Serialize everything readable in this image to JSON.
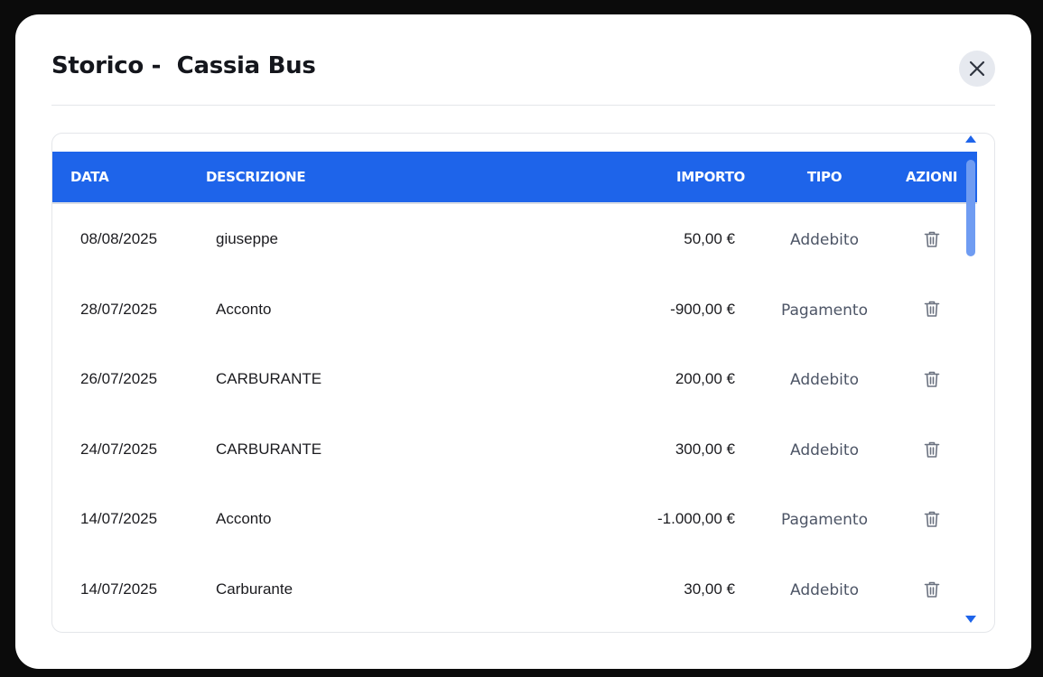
{
  "modal": {
    "title": "Storico -  Cassia Bus",
    "close_icon": "close-icon"
  },
  "table": {
    "headers": {
      "date": "DATA",
      "description": "DESCRIZIONE",
      "amount": "IMPORTO",
      "type": "TIPO",
      "actions": "AZIONI"
    },
    "rows": [
      {
        "date": "08/08/2025",
        "description": "giuseppe",
        "amount": "50,00 €",
        "type": "Addebito",
        "action_icon": "trash-icon"
      },
      {
        "date": "28/07/2025",
        "description": "Acconto",
        "amount": "-900,00 €",
        "type": "Pagamento",
        "action_icon": "trash-icon"
      },
      {
        "date": "26/07/2025",
        "description": "CARBURANTE",
        "amount": "200,00 €",
        "type": "Addebito",
        "action_icon": "trash-icon"
      },
      {
        "date": "24/07/2025",
        "description": "CARBURANTE",
        "amount": "300,00 €",
        "type": "Addebito",
        "action_icon": "trash-icon"
      },
      {
        "date": "14/07/2025",
        "description": "Acconto",
        "amount": "-1.000,00 €",
        "type": "Pagamento",
        "action_icon": "trash-icon"
      },
      {
        "date": "14/07/2025",
        "description": "Carburante",
        "amount": "30,00 €",
        "type": "Addebito",
        "action_icon": "trash-icon"
      }
    ]
  },
  "colors": {
    "accent": "#1e64ea",
    "header_text": "#ffffff",
    "type_text": "#4d5566",
    "icon": "#6b7280",
    "backdrop": "#0b0b0b"
  }
}
